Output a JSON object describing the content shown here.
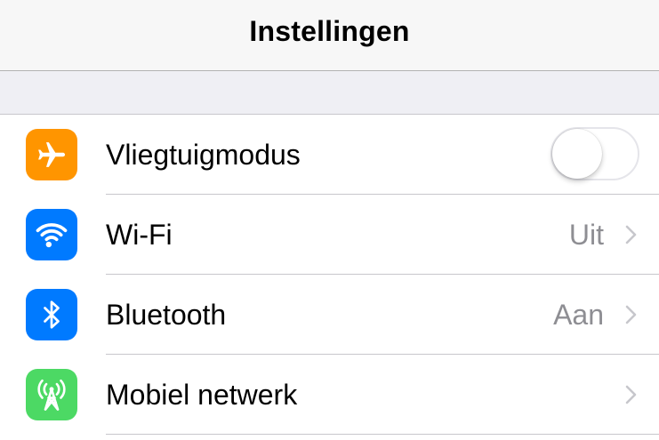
{
  "header": {
    "title": "Instellingen"
  },
  "settings": [
    {
      "label": "Vliegtuigmodus",
      "icon": "airplane-icon",
      "icon_color": "#ff9500",
      "control": "toggle",
      "toggle_on": false
    },
    {
      "label": "Wi-Fi",
      "icon": "wifi-icon",
      "icon_color": "#007aff",
      "control": "disclosure",
      "detail": "Uit"
    },
    {
      "label": "Bluetooth",
      "icon": "bluetooth-icon",
      "icon_color": "#007aff",
      "control": "disclosure",
      "detail": "Aan"
    },
    {
      "label": "Mobiel netwerk",
      "icon": "cellular-antenna-icon",
      "icon_color": "#4cd964",
      "control": "disclosure",
      "detail": ""
    }
  ],
  "colors": {
    "chevron": "#c7c7cc",
    "detail_text": "#8e8e93",
    "toggle_off_border": "#e5e5ea"
  }
}
